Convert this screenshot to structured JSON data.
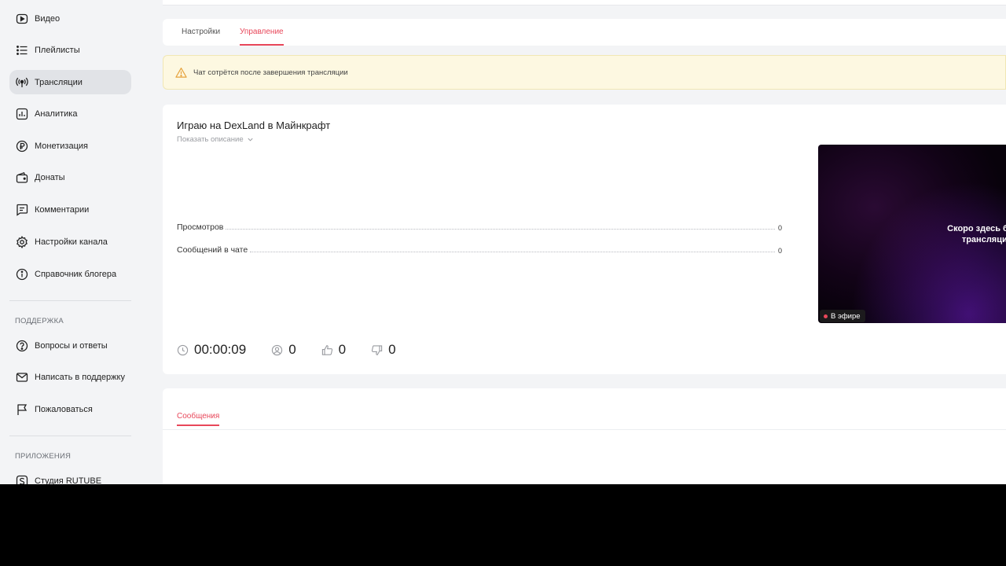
{
  "sidebar": {
    "items": [
      {
        "label": "Видео",
        "icon": "video-icon"
      },
      {
        "label": "Плейлисты",
        "icon": "list-icon"
      },
      {
        "label": "Трансляции",
        "icon": "broadcast-icon",
        "active": true
      },
      {
        "label": "Аналитика",
        "icon": "analytics-icon"
      },
      {
        "label": "Монетизация",
        "icon": "ruble-icon"
      },
      {
        "label": "Донаты",
        "icon": "wallet-icon"
      },
      {
        "label": "Комментарии",
        "icon": "comment-icon"
      },
      {
        "label": "Настройки канала",
        "icon": "gear-icon"
      },
      {
        "label": "Справочник блогера",
        "icon": "info-icon"
      }
    ],
    "support_heading": "ПОДДЕРЖКА",
    "support_items": [
      {
        "label": "Вопросы и ответы",
        "icon": "question-icon"
      },
      {
        "label": "Написать в поддержку",
        "icon": "mail-icon"
      },
      {
        "label": "Пожаловаться",
        "icon": "flag-icon"
      }
    ],
    "apps_heading": "ПРИЛОЖЕНИЯ",
    "apps_items": [
      {
        "label": "Студия RUTUBE",
        "icon": "studio-icon"
      }
    ]
  },
  "tabs": [
    {
      "label": "Настройки"
    },
    {
      "label": "Управление",
      "active": true
    }
  ],
  "warning": {
    "icon": "warning-icon",
    "text": "Чат сотрётся после завершения трансляции"
  },
  "stream": {
    "title": "Играю на DexLand в Майнкрафт",
    "show_description": "Показать описание",
    "stats": [
      {
        "label": "Просмотров",
        "value": "0"
      },
      {
        "label": "Сообщений в чате",
        "value": "0"
      }
    ],
    "counters": {
      "duration": "00:00:09",
      "viewers": "0",
      "likes": "0",
      "dislikes": "0"
    },
    "preview": {
      "text_line1": "Скоро здесь будет",
      "text_line2": "трансляция",
      "live_label": "В эфире"
    }
  },
  "chat": {
    "tab_label": "Сообщения"
  },
  "colors": {
    "accent": "#e8475a",
    "warning_bg": "#fdf8e1",
    "sidebar_bg": "#f3f4f6"
  }
}
